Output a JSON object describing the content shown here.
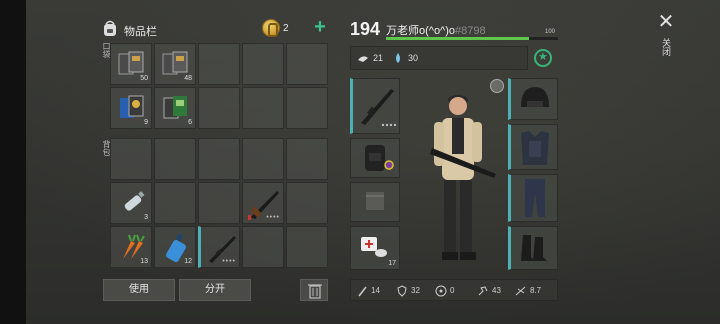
{
  "inventory": {
    "title": "物品栏",
    "coins": "2",
    "pocket_label": "口袋",
    "backpack_label": "背包",
    "pocket_slots": [
      {
        "item": "note-book-icon",
        "qty": "50"
      },
      {
        "item": "note-book-icon",
        "qty": "48"
      },
      {
        "item": "",
        "qty": ""
      },
      {
        "item": "",
        "qty": ""
      },
      {
        "item": "",
        "qty": ""
      },
      {
        "item": "blue-book-icon",
        "qty": "9"
      },
      {
        "item": "green-book-icon",
        "qty": "6"
      },
      {
        "item": "",
        "qty": ""
      },
      {
        "item": "",
        "qty": ""
      },
      {
        "item": "",
        "qty": ""
      }
    ],
    "backpack_slots": [
      {
        "item": "",
        "qty": ""
      },
      {
        "item": "",
        "qty": ""
      },
      {
        "item": "",
        "qty": ""
      },
      {
        "item": "",
        "qty": ""
      },
      {
        "item": "",
        "qty": ""
      },
      {
        "item": "water-bottle-icon",
        "qty": "3"
      },
      {
        "item": "",
        "qty": ""
      },
      {
        "item": "",
        "qty": ""
      },
      {
        "item": "shotgun-icon",
        "qty": ""
      },
      {
        "item": "",
        "qty": ""
      },
      {
        "item": "carrot-icon",
        "qty": "13"
      },
      {
        "item": "blue-bottle-icon",
        "qty": "12"
      },
      {
        "item": "rifle-icon",
        "qty": ""
      },
      {
        "item": "",
        "qty": ""
      },
      {
        "item": "",
        "qty": ""
      }
    ],
    "use_label": "使用",
    "split_label": "分开"
  },
  "character": {
    "level": "194",
    "name": "万老师o(^o^)o",
    "id": "#8798",
    "xp_max": "100",
    "xp_fraction": 0.83,
    "food": "21",
    "water": "30",
    "equip_qty": "17",
    "stats": {
      "attack": "14",
      "defense": "32",
      "radiation": "0",
      "speed": "43",
      "stealth": "8.7"
    }
  },
  "close_label": "关闭",
  "colors": {
    "accent_green": "#5ec64a",
    "accent_teal": "#4fb1b5",
    "plus_green": "#3ec28c"
  }
}
